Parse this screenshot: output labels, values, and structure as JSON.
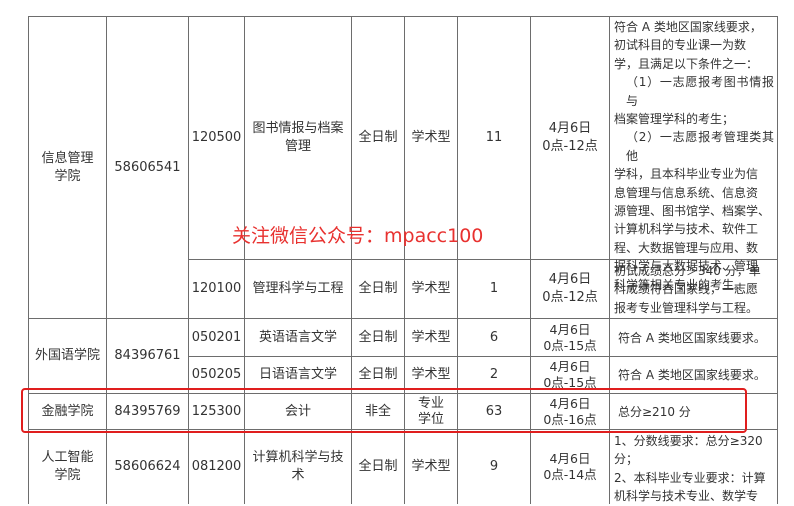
{
  "colors": {
    "border": "#6d6d6d",
    "text": "#333333",
    "highlight": "#e01e1e",
    "watermark": "#e8312f"
  },
  "watermark": "关注微信公众号：mpacc100",
  "rows": [
    {
      "college": "信息管理\n学院",
      "phone": "58606541",
      "majors": [
        {
          "code": "120500",
          "name": "图书情报与档案\n管理",
          "mode": "全日制",
          "type": "学术型",
          "count": "11",
          "time": "4月6日\n0点-12点",
          "requirement": [
            "符合 A 类地区国家线要求，",
            "初试科目的专业课一为数",
            "学，且满足以下条件之一：",
            "（1）一志愿报考图书情报与",
            "档案管理学科的考生；",
            "（2）一志愿报考管理类其他",
            "学科，且本科毕业专业为信",
            "息管理与信息系统、信息资",
            "源管理、图书馆学、档案学、",
            "计算机科学与技术、软件工",
            "程、大数据管理与应用、数",
            "据科学与大数据技术、管理",
            "科学等相关专业的考生。"
          ]
        },
        {
          "code": "120100",
          "name": "管理科学与工程",
          "mode": "全日制",
          "type": "学术型",
          "count": "1",
          "time": "4月6日\n0点-12点",
          "requirement": [
            "初试成绩总分＞340 分，单",
            "科成绩符合国家线，一志愿",
            "报考专业管理科学与工程。"
          ]
        }
      ]
    },
    {
      "college": "外国语学院",
      "phone": "84396761",
      "majors": [
        {
          "code": "050201",
          "name": "英语语言文学",
          "mode": "全日制",
          "type": "学术型",
          "count": "6",
          "time": "4月6日\n0点-15点",
          "requirement": [
            "符合 A 类地区国家线要求。"
          ]
        },
        {
          "code": "050205",
          "name": "日语语言文学",
          "mode": "全日制",
          "type": "学术型",
          "count": "2",
          "time": "4月6日\n0点-15点",
          "requirement": [
            "符合 A 类地区国家线要求。"
          ]
        }
      ]
    },
    {
      "college": "金融学院",
      "phone": "84395769",
      "majors": [
        {
          "code": "125300",
          "name": "会计",
          "mode": "非全",
          "type": "专业\n学位",
          "count": "63",
          "time": "4月6日\n0点-16点",
          "requirement": [
            "总分≥210 分"
          ]
        }
      ]
    },
    {
      "college": "人工智能\n学院",
      "phone": "58606624",
      "majors": [
        {
          "code": "081200",
          "name": "计算机科学与技\n术",
          "mode": "全日制",
          "type": "学术型",
          "count": "9",
          "time": "4月6日\n0点-14点",
          "requirement": [
            "1、分数线要求：总分≥320",
            "分；",
            "2、本科毕业专业要求：计算",
            "机科学与技术专业、数学专"
          ]
        }
      ]
    }
  ]
}
